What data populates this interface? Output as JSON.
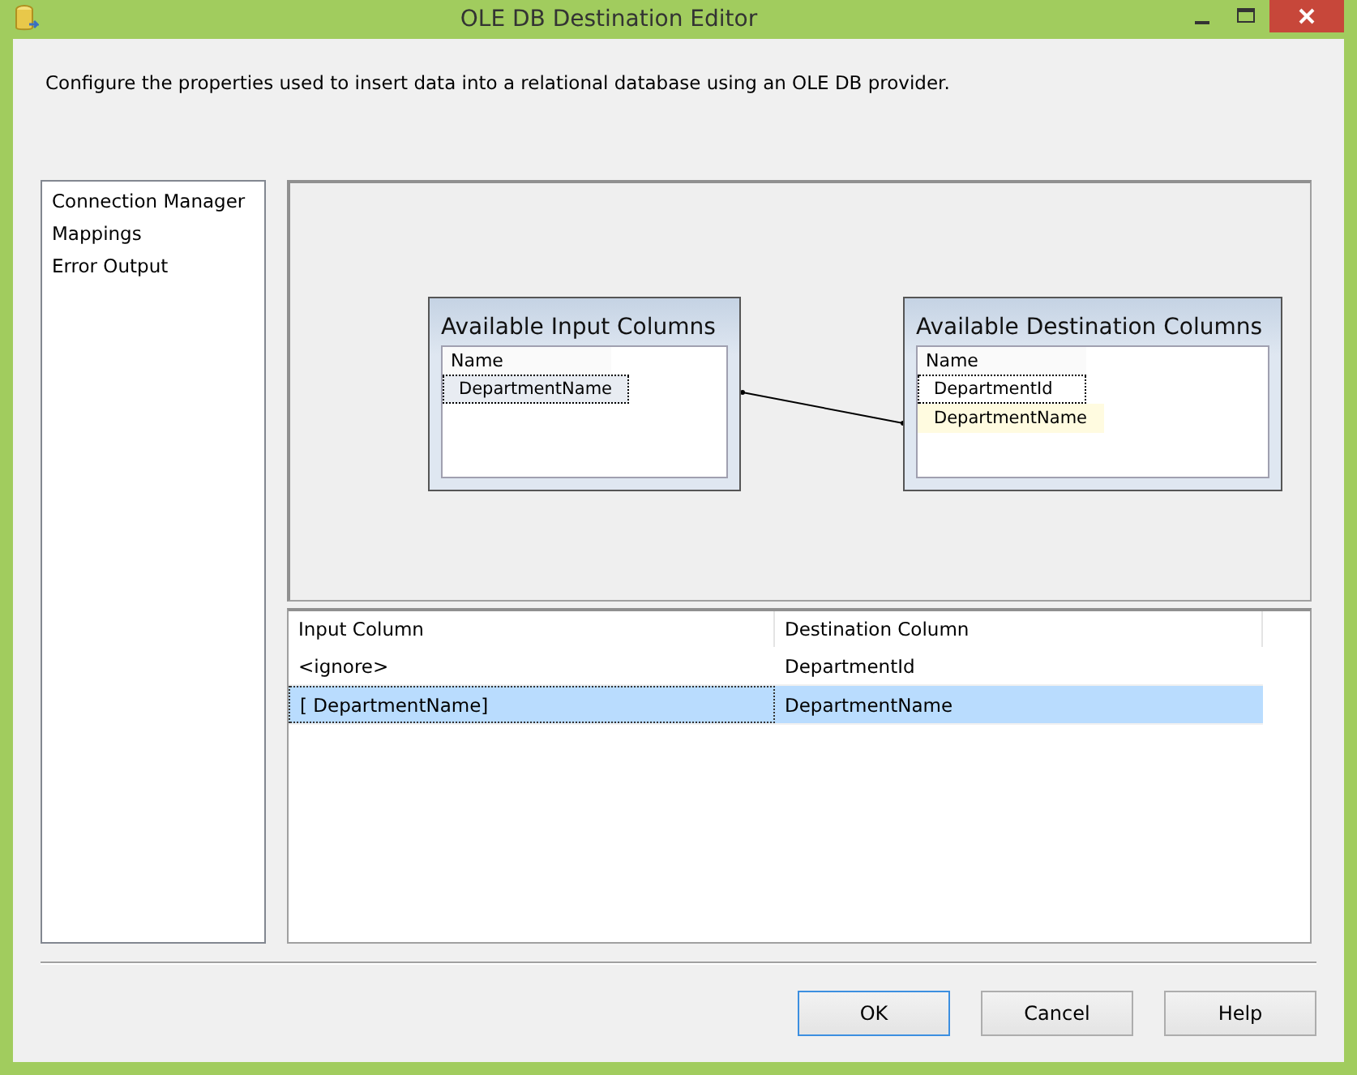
{
  "window": {
    "title": "OLE DB Destination Editor"
  },
  "description": "Configure the properties used to insert data into a relational database using an OLE DB provider.",
  "sidebar": {
    "items": [
      {
        "label": "Connection Manager"
      },
      {
        "label": "Mappings"
      },
      {
        "label": "Error Output"
      }
    ]
  },
  "diagram": {
    "input": {
      "title": "Available Input Columns",
      "header": "Name",
      "rows": [
        {
          "name": "DepartmentName",
          "focused": true,
          "highlighted": false
        }
      ]
    },
    "destination": {
      "title": "Available Destination Columns",
      "header": "Name",
      "rows": [
        {
          "name": "DepartmentId",
          "focused": true,
          "highlighted": false
        },
        {
          "name": "DepartmentName",
          "focused": false,
          "highlighted": true
        }
      ]
    }
  },
  "grid": {
    "columns": [
      "Input Column",
      "Destination Column"
    ],
    "rows": [
      {
        "cells": [
          "<ignore>",
          "DepartmentId"
        ],
        "selected": false
      },
      {
        "cells": [
          "[ DepartmentName]",
          "DepartmentName"
        ],
        "selected": true
      }
    ]
  },
  "buttons": [
    {
      "label": "OK",
      "default": true
    },
    {
      "label": "Cancel",
      "default": false
    },
    {
      "label": "Help",
      "default": false
    }
  ]
}
